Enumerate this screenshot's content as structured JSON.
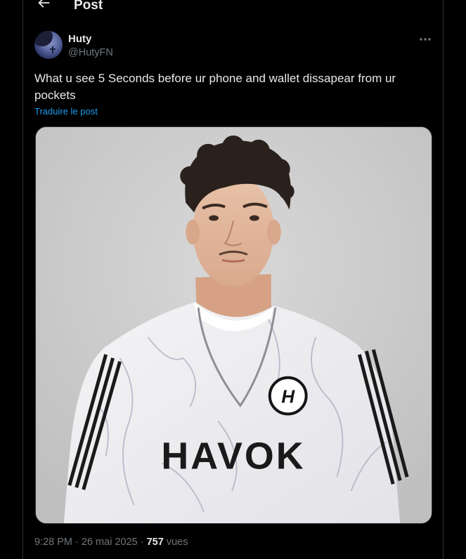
{
  "header": {
    "title": "Post",
    "back_icon": "arrow-left-icon"
  },
  "author": {
    "name": "Huty",
    "handle": "@HutyFN"
  },
  "tweet": {
    "text": "What u see 5 Seconds before ur phone and wallet dissapear from ur pockets",
    "translate_label": "Traduire le post"
  },
  "media": {
    "logo_text": "HAVOK",
    "badge_text": "H"
  },
  "meta": {
    "time": "9:28 PM",
    "separator1": " · ",
    "date": "26 mai 2025",
    "separator2": " · ",
    "views": "757",
    "views_label": " vues"
  },
  "colors": {
    "accent": "#1d9bf0",
    "secondary_text": "#71767b",
    "primary_text": "#e7e9ea",
    "border": "#2f3336"
  }
}
